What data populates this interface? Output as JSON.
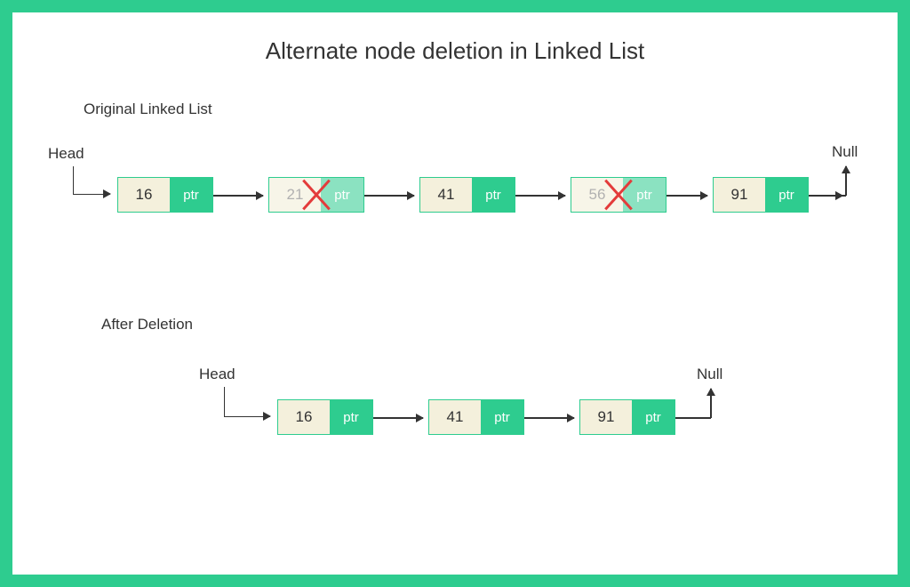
{
  "title": "Alternate node deletion in Linked List",
  "section1": {
    "label": "Original Linked List",
    "head": "Head",
    "null": "Null",
    "nodes": [
      {
        "val": "16",
        "ptr": "ptr",
        "deleted": false
      },
      {
        "val": "21",
        "ptr": "ptr",
        "deleted": true
      },
      {
        "val": "41",
        "ptr": "ptr",
        "deleted": false
      },
      {
        "val": "56",
        "ptr": "ptr",
        "deleted": true
      },
      {
        "val": "91",
        "ptr": "ptr",
        "deleted": false
      }
    ]
  },
  "section2": {
    "label": "After  Deletion",
    "head": "Head",
    "null": "Null",
    "nodes": [
      {
        "val": "16",
        "ptr": "ptr"
      },
      {
        "val": "41",
        "ptr": "ptr"
      },
      {
        "val": "91",
        "ptr": "ptr"
      }
    ]
  }
}
